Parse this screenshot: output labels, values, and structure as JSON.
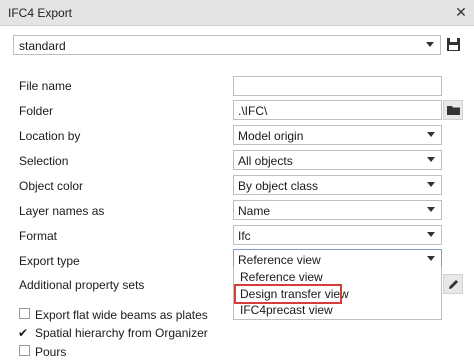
{
  "window": {
    "title": "IFC4 Export"
  },
  "preset": {
    "value": "standard"
  },
  "labels": {
    "file_name": "File name",
    "folder": "Folder",
    "location_by": "Location by",
    "selection": "Selection",
    "object_color": "Object color",
    "layer_names_as": "Layer names as",
    "format": "Format",
    "export_type": "Export type",
    "additional_property_sets": "Additional property sets"
  },
  "fields": {
    "file_name": "",
    "folder": ".\\IFC\\",
    "location_by": "Model origin",
    "selection": "All objects",
    "object_color": "By object class",
    "layer_names_as": "Name",
    "format": "Ifc",
    "export_type": "Reference view"
  },
  "export_type_options": [
    "Reference view",
    "Design transfer view",
    "IFC4precast view"
  ],
  "checkboxes": [
    {
      "label": "Export flat wide beams as plates",
      "checked": false
    },
    {
      "label": "Spatial hierarchy from Organizer",
      "checked": true
    },
    {
      "label": "Pours",
      "checked": false
    }
  ],
  "icons": {
    "close": "close-icon",
    "save": "save-icon",
    "folder": "folder-icon",
    "edit": "pencil-icon",
    "dropdown": "chevron-down-icon"
  },
  "colors": {
    "highlight": "#d43f3a"
  }
}
